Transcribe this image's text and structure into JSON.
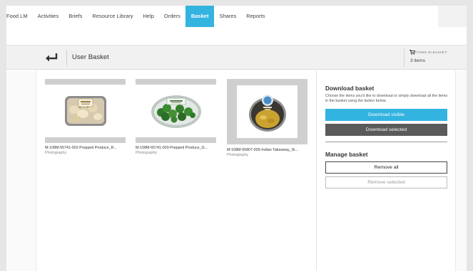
{
  "nav": {
    "items": [
      {
        "label": "Food LM",
        "active": false
      },
      {
        "label": "Activities",
        "active": false
      },
      {
        "label": "Briefs",
        "active": false
      },
      {
        "label": "Resource Library",
        "active": false
      },
      {
        "label": "Help",
        "active": false
      },
      {
        "label": "Orders",
        "active": false
      },
      {
        "label": "Basket",
        "active": true
      },
      {
        "label": "Shares",
        "active": false
      },
      {
        "label": "Reports",
        "active": false
      }
    ]
  },
  "header": {
    "back_icon": "return-arrow-icon",
    "title": "User Basket",
    "cart_icon": "cart-icon",
    "items_label": "ITEMS IN BASKET:",
    "items_count": "3 items"
  },
  "assets": [
    {
      "filename": "M-108M-65741-002-Prepped Produce_R...",
      "type": "Photography",
      "thumbnail": "potato-tray"
    },
    {
      "filename": "M-108M-65741-003-Prepped Produce_G...",
      "type": "Photography",
      "thumbnail": "broccoli-tray"
    },
    {
      "filename": "M-108M-65807-005-Indian Takeaway_Si...",
      "type": "Photography",
      "thumbnail": "coop-curry-pack"
    }
  ],
  "sidebar": {
    "download_heading": "Download basket",
    "download_description": "Choose the items you'd like to download or simply download all the items in the basket using the button below.",
    "download_visible_label": "Download visible",
    "download_selected_label": "Download selected",
    "manage_heading": "Manage basket",
    "remove_all_label": "Remove all",
    "remove_selected_label": "Remove selected"
  },
  "colors": {
    "accent": "#33b3e0",
    "dark_button": "#5a5a5a"
  }
}
